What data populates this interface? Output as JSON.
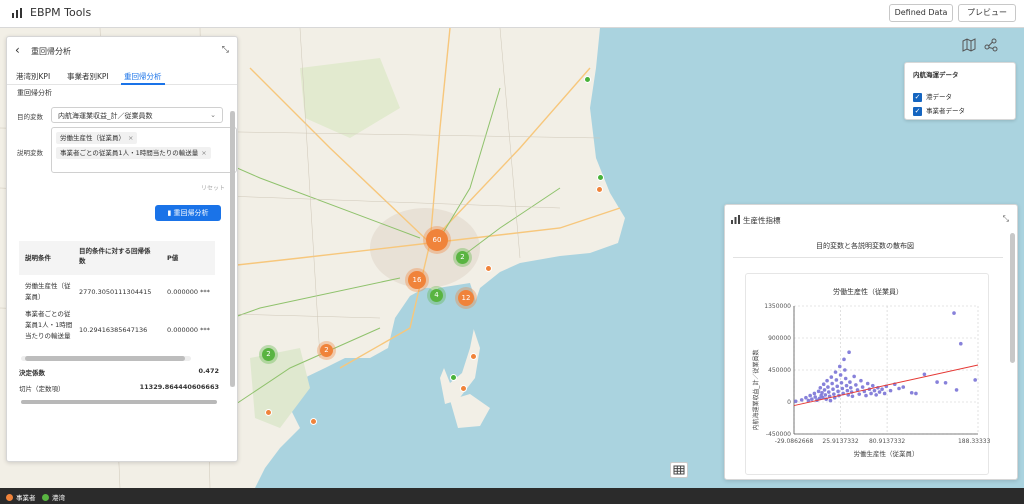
{
  "app": {
    "title": "EBPM Tools"
  },
  "header": {
    "defined_data_label": "Defined Data",
    "preview_label": "プレビュー"
  },
  "left_panel": {
    "title": "重回帰分析",
    "tabs": [
      {
        "label": "港湾別KPI"
      },
      {
        "label": "事業者別KPI"
      },
      {
        "label": "重回帰分析"
      }
    ],
    "section_title": "重回帰分析",
    "target_label": "目的変数",
    "target_value": "内航海運業収益_計／従業員数",
    "explanatory_label": "説明変数",
    "chips": [
      {
        "label": "労働生産性（従業員）"
      },
      {
        "label": "事業者ごとの従業員1人・1時間当たりの輸送量"
      }
    ],
    "reset_label": "リセット",
    "run_button": "重回帰分析",
    "table": {
      "headers": [
        "説明条件",
        "目的条件に対する回帰係数",
        "P値"
      ],
      "rows": [
        {
          "name": "労働生産性（従業員）",
          "coef": "2770.3050111304415",
          "p": "0.000000 ***"
        },
        {
          "name": "事業者ごとの従業員1人・1時間当たりの輸送量",
          "coef": "10.29416385647136",
          "p": "0.000000 ***"
        }
      ]
    },
    "r2_label": "決定係数",
    "r2_value": "0.472",
    "intercept_label": "切片（定数項）",
    "intercept_value": "11329.864440606663"
  },
  "legend_box": {
    "title": "内航海運データ",
    "items": [
      {
        "label": "港データ"
      },
      {
        "label": "事業者データ"
      }
    ]
  },
  "map_clusters": [
    {
      "count": "60",
      "color": "orange"
    },
    {
      "count": "16",
      "color": "orange"
    },
    {
      "count": "12",
      "color": "orange"
    },
    {
      "count": "2",
      "color": "orange"
    },
    {
      "count": "2",
      "color": "green"
    },
    {
      "count": "4",
      "color": "green"
    },
    {
      "count": "2",
      "color": "green"
    }
  ],
  "chart_panel": {
    "title": "生産性指標",
    "subtitle": "目的変数と各説明変数の散布図"
  },
  "chart_data": {
    "type": "scatter",
    "title": "労働生産性（従業員）",
    "xlabel": "労働生産性（従業員）",
    "ylabel": "内航海運業収益_計／従業員数",
    "xlim": [
      -29.0862668,
      188.3333333
    ],
    "ylim": [
      -450000,
      1350000
    ],
    "xticks": [
      "-29.0862668",
      "25.9137332",
      "80.9137332",
      "188.3333333"
    ],
    "yticks": [
      "1350000",
      "900000",
      "450000",
      "0",
      "-450000"
    ],
    "grid": true,
    "point_color": "#7a73d6",
    "regression_line": {
      "color": "#e53935",
      "x": [
        -29.0862668,
        188.3333333
      ],
      "y": [
        -50000,
        520000
      ]
    },
    "points": [
      [
        -27,
        10000
      ],
      [
        -20,
        30000
      ],
      [
        -15,
        60000
      ],
      [
        -12,
        20000
      ],
      [
        -10,
        90000
      ],
      [
        -8,
        40000
      ],
      [
        -5,
        120000
      ],
      [
        -4,
        70000
      ],
      [
        -2,
        25000
      ],
      [
        0,
        150000
      ],
      [
        1,
        50000
      ],
      [
        2,
        200000
      ],
      [
        3,
        90000
      ],
      [
        4,
        130000
      ],
      [
        5,
        60000
      ],
      [
        6,
        250000
      ],
      [
        7,
        170000
      ],
      [
        8,
        100000
      ],
      [
        9,
        40000
      ],
      [
        10,
        300000
      ],
      [
        11,
        210000
      ],
      [
        12,
        140000
      ],
      [
        13,
        80000
      ],
      [
        14,
        20000
      ],
      [
        15,
        350000
      ],
      [
        16,
        260000
      ],
      [
        17,
        180000
      ],
      [
        18,
        110000
      ],
      [
        19,
        60000
      ],
      [
        20,
        420000
      ],
      [
        21,
        310000
      ],
      [
        22,
        220000
      ],
      [
        23,
        150000
      ],
      [
        24,
        90000
      ],
      [
        25,
        500000
      ],
      [
        26,
        380000
      ],
      [
        27,
        270000
      ],
      [
        28,
        190000
      ],
      [
        29,
        120000
      ],
      [
        30,
        600000
      ],
      [
        31,
        450000
      ],
      [
        32,
        330000
      ],
      [
        33,
        230000
      ],
      [
        34,
        160000
      ],
      [
        35,
        100000
      ],
      [
        36,
        700000
      ],
      [
        37,
        280000
      ],
      [
        38,
        200000
      ],
      [
        39,
        140000
      ],
      [
        40,
        80000
      ],
      [
        42,
        360000
      ],
      [
        44,
        240000
      ],
      [
        46,
        170000
      ],
      [
        48,
        110000
      ],
      [
        50,
        300000
      ],
      [
        52,
        210000
      ],
      [
        54,
        150000
      ],
      [
        56,
        90000
      ],
      [
        58,
        260000
      ],
      [
        60,
        180000
      ],
      [
        62,
        120000
      ],
      [
        64,
        230000
      ],
      [
        66,
        160000
      ],
      [
        68,
        100000
      ],
      [
        70,
        200000
      ],
      [
        72,
        140000
      ],
      [
        75,
        180000
      ],
      [
        78,
        120000
      ],
      [
        80,
        220000
      ],
      [
        85,
        160000
      ],
      [
        90,
        250000
      ],
      [
        95,
        190000
      ],
      [
        100,
        210000
      ],
      [
        110,
        130000
      ],
      [
        115,
        120000
      ],
      [
        125,
        390000
      ],
      [
        140,
        280000
      ],
      [
        150,
        270000
      ],
      [
        160,
        1250000
      ],
      [
        163,
        170000
      ],
      [
        168,
        820000
      ],
      [
        185,
        310000
      ]
    ]
  },
  "bottom_legend": [
    {
      "label": "事業者",
      "color": "#f0833a"
    },
    {
      "label": "港湾",
      "color": "#59b441"
    }
  ]
}
